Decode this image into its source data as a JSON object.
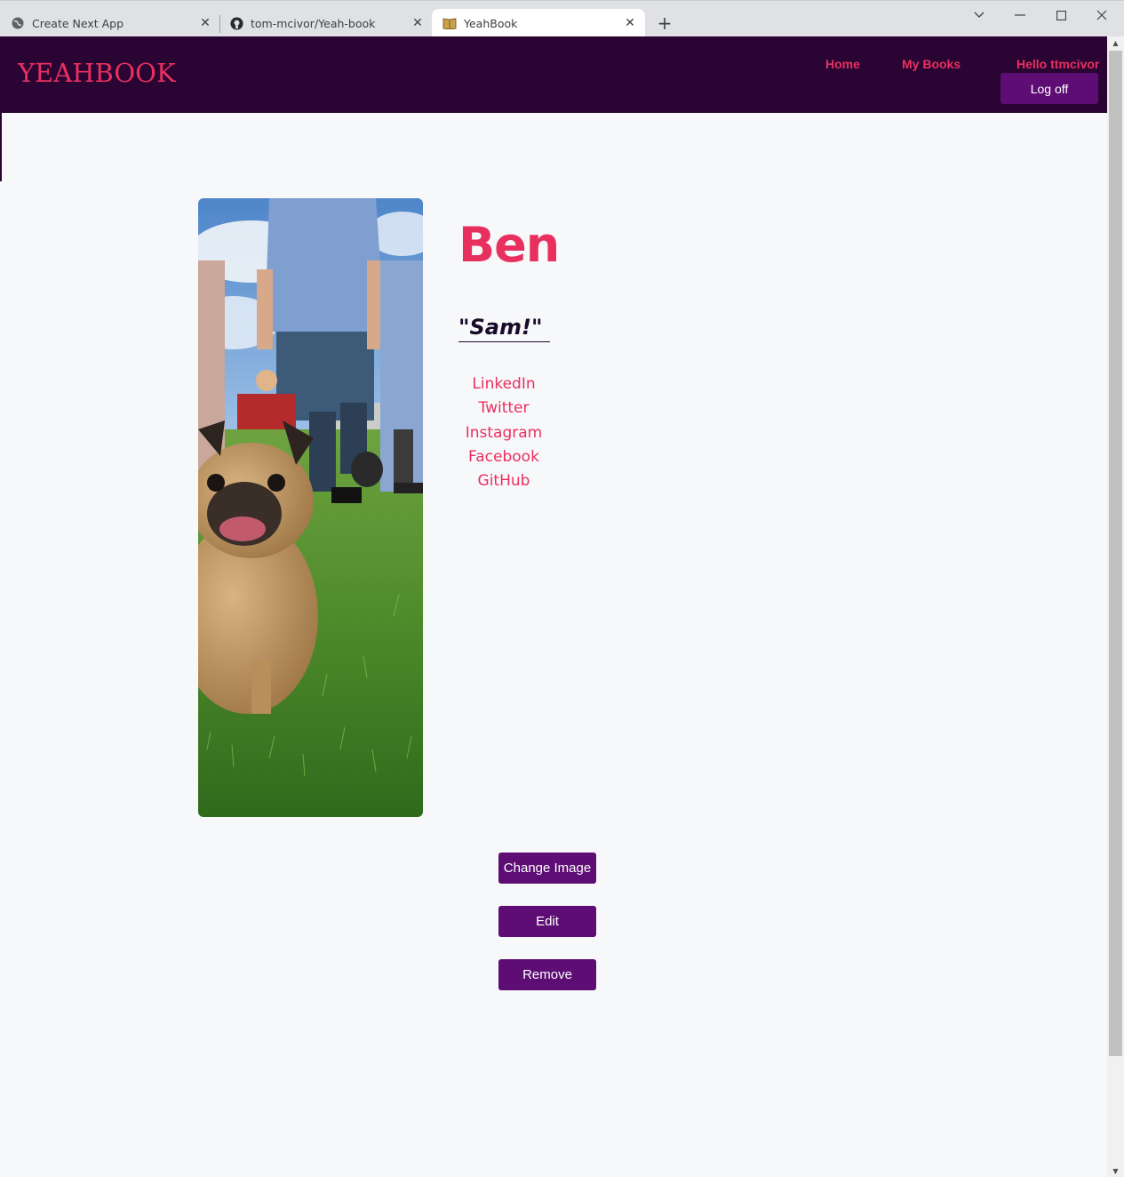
{
  "browser": {
    "tabs": [
      {
        "title": "Create Next App",
        "favicon": "globe-icon",
        "active": false
      },
      {
        "title": "tom-mcivor/Yeah-book",
        "favicon": "github-icon",
        "active": false
      },
      {
        "title": "YeahBook",
        "favicon": "book-icon",
        "active": true
      }
    ]
  },
  "header": {
    "logo": "YEAHBOOK",
    "nav": {
      "home": "Home",
      "my_books": "My Books"
    },
    "greeting": "Hello ttmcivor",
    "logoff_label": "Log off"
  },
  "profile": {
    "name": "Ben",
    "quote": "\"Sam!\"",
    "photo_alt": "pug-photo",
    "socials": [
      "LinkedIn",
      "Twitter",
      "Instagram",
      "Facebook",
      "GitHub"
    ]
  },
  "actions": {
    "change_image": "Change Image",
    "edit": "Edit",
    "remove": "Remove"
  },
  "colors": {
    "navbar_bg": "#2a0433",
    "accent": "#e8305f",
    "button_bg": "#5d0d74",
    "page_bg": "#f7f8fa"
  }
}
